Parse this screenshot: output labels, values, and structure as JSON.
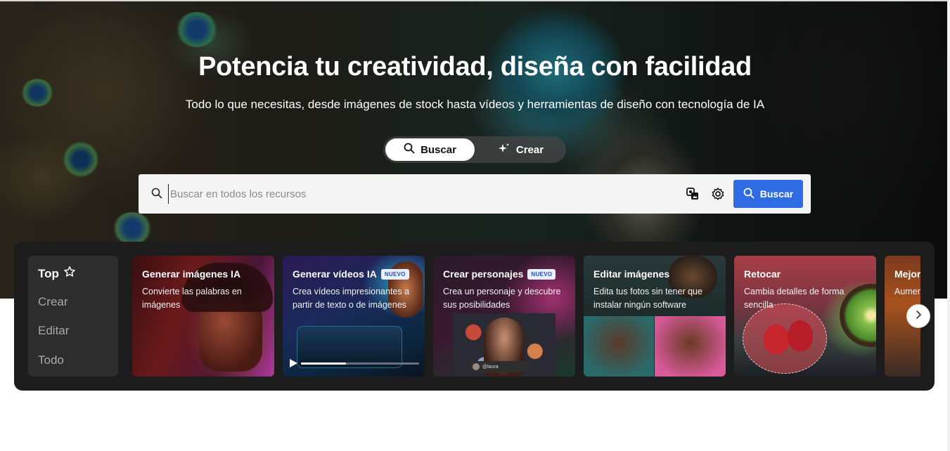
{
  "hero": {
    "title": "Potencia tu creatividad, diseña con facilidad",
    "subtitle": "Todo lo que necesitas, desde imágenes de stock hasta vídeos y herramientas de diseño con tecnología de IA"
  },
  "mode_toggle": {
    "search_label": "Buscar",
    "create_label": "Crear",
    "active": "Buscar"
  },
  "search": {
    "placeholder": "Buscar en todos los recursos",
    "value": "",
    "submit_label": "Buscar"
  },
  "categories": {
    "items": [
      {
        "label": "Top"
      },
      {
        "label": "Crear"
      },
      {
        "label": "Editar"
      },
      {
        "label": "Todo"
      }
    ],
    "active": "Top"
  },
  "cards": [
    {
      "title": "Generar imágenes IA",
      "description": "Convierte las palabras en imágenes",
      "badge": ""
    },
    {
      "title": "Generar vídeos IA",
      "description": "Crea vídeos impresionantes a partir de texto o de imágenes",
      "badge": "NUEVO"
    },
    {
      "title": "Crear personajes",
      "description": "Crea un personaje y descubre sus posibilidades",
      "badge": "NUEVO",
      "tag": "@laura"
    },
    {
      "title": "Editar imágenes",
      "description": "Edita tus fotos sin tener que instalar ningún software",
      "badge": ""
    },
    {
      "title": "Retocar",
      "description": "Cambia detalles de forma sencilla",
      "badge": ""
    },
    {
      "title": "Mejorar",
      "description": "Aumenta detalles",
      "badge": ""
    }
  ],
  "icons": {
    "search": "search-icon",
    "sparkle": "sparkle-icon",
    "image_search": "image-search-icon",
    "settings": "gear-icon",
    "star": "star-outline-icon",
    "play": "play-icon",
    "next": "chevron-right-icon"
  },
  "colors": {
    "accent": "#2f6be3",
    "panel": "#1c1c1c",
    "badge_bg": "#e8efff"
  }
}
